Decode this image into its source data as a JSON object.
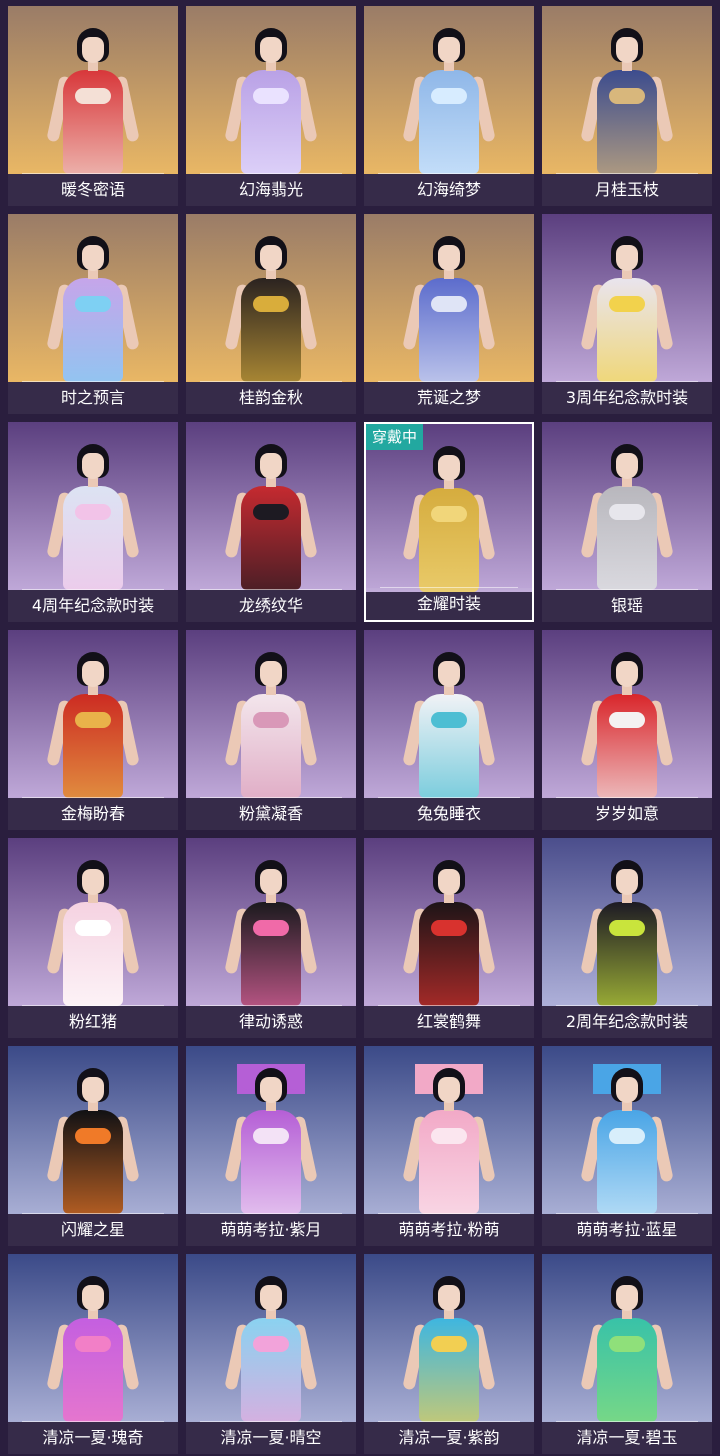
{
  "status_badge": "穿戴中",
  "skins": [
    {
      "name": "暖冬密语",
      "bg": [
        "#9a7c67",
        "#e9b765"
      ],
      "outfit": "#d8373a",
      "accent": "#f4e0d6",
      "worn": false
    },
    {
      "name": "幻海翡光",
      "bg": [
        "#9a7c67",
        "#e9b765"
      ],
      "outfit": "#b9a1e6",
      "accent": "#eae2ff",
      "worn": false
    },
    {
      "name": "幻海绮梦",
      "bg": [
        "#9a7c67",
        "#e9b765"
      ],
      "outfit": "#8fb7e8",
      "accent": "#d7ecff",
      "worn": false
    },
    {
      "name": "月桂玉枝",
      "bg": [
        "#9a7c67",
        "#e9b765"
      ],
      "outfit": "#3c4c8e",
      "accent": "#d8b77c",
      "worn": false
    },
    {
      "name": "时之预言",
      "bg": [
        "#9a7c67",
        "#e9b765"
      ],
      "outfit": "#c6a5ea",
      "accent": "#7ed0f3",
      "worn": false
    },
    {
      "name": "桂韵金秋",
      "bg": [
        "#9a7c67",
        "#e9b765"
      ],
      "outfit": "#2b2320",
      "accent": "#d9ad3b",
      "worn": false
    },
    {
      "name": "荒诞之梦",
      "bg": [
        "#9a7c67",
        "#e9b765"
      ],
      "outfit": "#5c6ccc",
      "accent": "#dfe4f6",
      "worn": false
    },
    {
      "name": "3周年纪念款时装",
      "bg": [
        "#5b3f7f",
        "#bfa8d8"
      ],
      "outfit": "#e9e4ee",
      "accent": "#f2d24c",
      "worn": false
    },
    {
      "name": "4周年纪念款时装",
      "bg": [
        "#5b3f7f",
        "#bfa8d8"
      ],
      "outfit": "#dce3f3",
      "accent": "#f2c3e8",
      "worn": false
    },
    {
      "name": "龙绣纹华",
      "bg": [
        "#5b3f7f",
        "#bfa8d8"
      ],
      "outfit": "#c52a30",
      "accent": "#1d1a22",
      "worn": false
    },
    {
      "name": "金耀时装",
      "bg": [
        "#5b3f7f",
        "#bfa8d8"
      ],
      "outfit": "#d5ac3e",
      "accent": "#f1d67a",
      "worn": true
    },
    {
      "name": "银瑶",
      "bg": [
        "#5b3f7f",
        "#bfa8d8"
      ],
      "outfit": "#b8b7bd",
      "accent": "#e7e6ec",
      "worn": false
    },
    {
      "name": "金梅盼春",
      "bg": [
        "#5b3f7f",
        "#bfa8d8"
      ],
      "outfit": "#cc2b22",
      "accent": "#e9b24a",
      "worn": false
    },
    {
      "name": "粉黛凝香",
      "bg": [
        "#5b3f7f",
        "#bfa8d8"
      ],
      "outfit": "#f3e6ec",
      "accent": "#d998b8",
      "worn": false
    },
    {
      "name": "兔兔睡衣",
      "bg": [
        "#5b3f7f",
        "#bfa8d8"
      ],
      "outfit": "#f1f2f6",
      "accent": "#4dbed3",
      "worn": false
    },
    {
      "name": "岁岁如意",
      "bg": [
        "#5b3f7f",
        "#bfa8d8"
      ],
      "outfit": "#d9262b",
      "accent": "#f4f2f2",
      "worn": false
    },
    {
      "name": "粉红猪",
      "bg": [
        "#5b3f7f",
        "#bfa8d8"
      ],
      "outfit": "#f5d2e1",
      "accent": "#ffffff",
      "worn": false
    },
    {
      "name": "律动诱惑",
      "bg": [
        "#5b3f7f",
        "#bfa8d8"
      ],
      "outfit": "#1b1a1e",
      "accent": "#f06aa8",
      "worn": false
    },
    {
      "name": "红裳鹤舞",
      "bg": [
        "#5b3f7f",
        "#bfa8d8"
      ],
      "outfit": "#1d1417",
      "accent": "#d8322e",
      "worn": false
    },
    {
      "name": "2周年纪念款时装",
      "bg": [
        "#4b4e8c",
        "#aeb0d9"
      ],
      "outfit": "#1d1a24",
      "accent": "#c9e43c",
      "worn": false
    },
    {
      "name": "闪耀之星",
      "bg": [
        "#3b4a88",
        "#a8aed4"
      ],
      "outfit": "#111114",
      "accent": "#f07a28",
      "worn": false
    },
    {
      "name": "萌萌考拉·紫月",
      "bg": [
        "#3b4a88",
        "#a8aed4"
      ],
      "outfit": "#b55fd6",
      "accent": "#f3e2f6",
      "worn": false
    },
    {
      "name": "萌萌考拉·粉萌",
      "bg": [
        "#3b4a88",
        "#a8aed4"
      ],
      "outfit": "#f2a9c7",
      "accent": "#fbe6ef",
      "worn": false
    },
    {
      "name": "萌萌考拉·蓝星",
      "bg": [
        "#3b4a88",
        "#a8aed4"
      ],
      "outfit": "#4aa5e6",
      "accent": "#d8eefb",
      "worn": false
    },
    {
      "name": "清凉一夏·瑰奇",
      "bg": [
        "#3b4a88",
        "#a8aed4"
      ],
      "outfit": "#c45fe0",
      "accent": "#f27fc7",
      "worn": false
    },
    {
      "name": "清凉一夏·晴空",
      "bg": [
        "#3b4a88",
        "#a8aed4"
      ],
      "outfit": "#8ad2f0",
      "accent": "#f2a3da",
      "worn": false
    },
    {
      "name": "清凉一夏·紫韵",
      "bg": [
        "#3b4a88",
        "#a8aed4"
      ],
      "outfit": "#3eb6e0",
      "accent": "#f2cf52",
      "worn": false
    },
    {
      "name": "清凉一夏·碧玉",
      "bg": [
        "#3b4a88",
        "#a8aed4"
      ],
      "outfit": "#38c2a8",
      "accent": "#8fe07a",
      "worn": false
    }
  ]
}
